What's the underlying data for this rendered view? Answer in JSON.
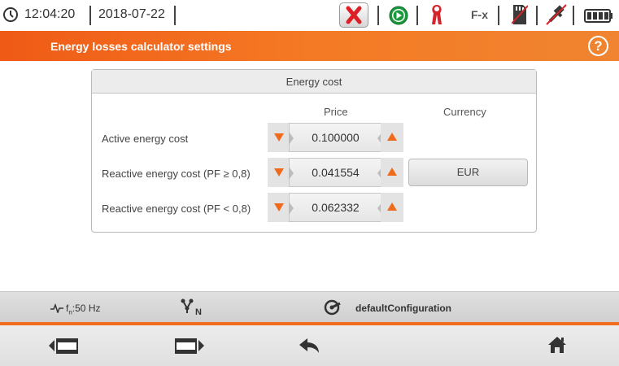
{
  "status": {
    "time": "12:04:20",
    "date": "2018-07-22",
    "fx_label": "F-x",
    "icons": [
      "clock-icon",
      "stop-red-x-icon",
      "record-play-icon",
      "clamp-icon",
      "sd-card-icon",
      "usb-icon",
      "battery-icon"
    ],
    "colors": {
      "stop": "#dd1f26",
      "play": "#1a9a3d",
      "clamp": "#d4232a"
    }
  },
  "header": {
    "title": "Energy losses calculator settings",
    "help_label": "?"
  },
  "panel": {
    "title": "Energy cost",
    "columns": {
      "price": "Price",
      "currency": "Currency"
    },
    "rows": [
      {
        "label": "Active energy cost",
        "value": "0.100000"
      },
      {
        "label": "Reactive energy cost (PF ≥ 0,8)",
        "value": "0.041554"
      },
      {
        "label": "Reactive energy cost (PF < 0,8)",
        "value": "0.062332"
      }
    ],
    "currency": "EUR"
  },
  "info": {
    "frequency": "fn:50 Hz",
    "frequency_main": "f",
    "frequency_sub": "n",
    "frequency_rest": ":50 Hz",
    "network_label": "N",
    "config": "defaultConfiguration"
  },
  "footer": {
    "keys": [
      "prev-screen-icon",
      "next-screen-icon",
      "back-arrow-icon",
      "home-icon"
    ],
    "accent": "#f26d1f"
  }
}
